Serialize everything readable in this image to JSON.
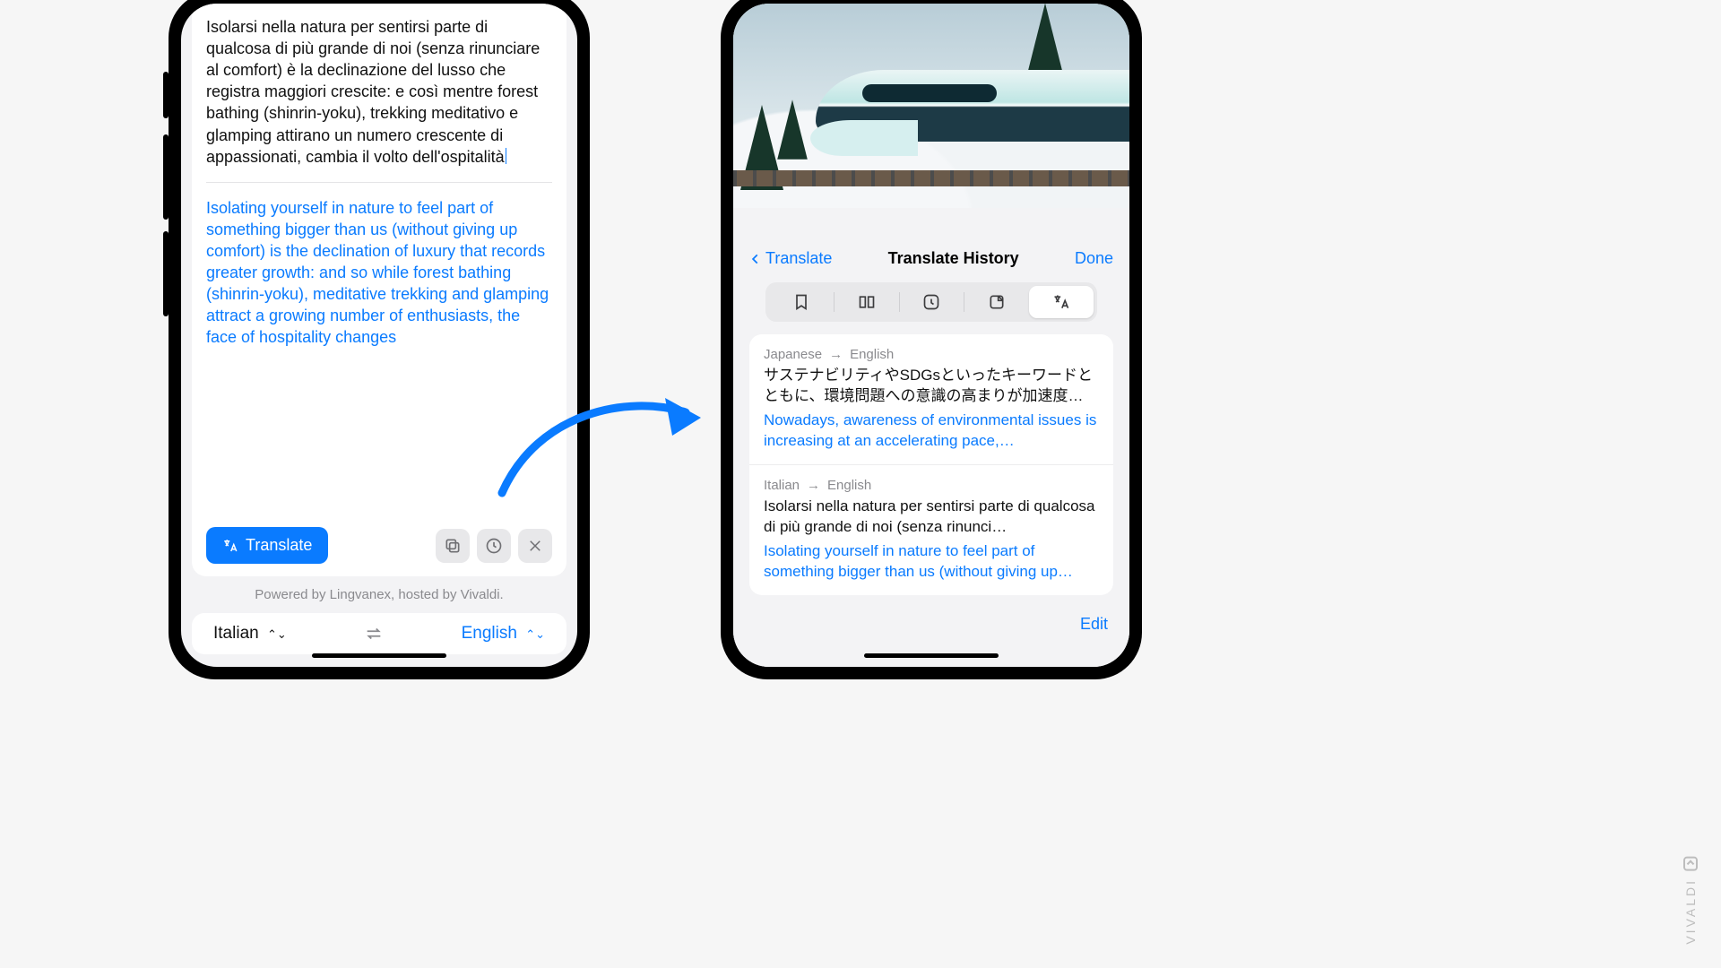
{
  "left": {
    "source_text": "Isolarsi nella natura per sentirsi parte di qualcosa di più grande di noi (senza rinunciare al comfort) è la declinazione del lusso che registra maggiori crescite: e così mentre forest bathing (shinrin-yoku), trekking meditativo e glamping attirano un numero crescente di appassionati, cambia il volto dell'ospitalità",
    "target_text": "Isolating yourself in nature to feel part of something bigger than us (without giving up comfort) is the declination of luxury that records greater growth: and so while forest bathing (shinrin-yoku), meditative trekking and glamping attract a growing number of enthusiasts, the face of hospitality changes",
    "translate_button": "Translate",
    "powered_by": "Powered by Lingvanex, hosted by Vivaldi.",
    "lang_from": "Italian",
    "lang_to": "English"
  },
  "right": {
    "back_label": "Translate",
    "title": "Translate History",
    "done_label": "Done",
    "edit_label": "Edit",
    "history": [
      {
        "from": "Japanese",
        "to": "English",
        "src": "サステナビリティやSDGsといったキーワードとともに、環境問題への意識の高まりが加速度…",
        "tgt": "Nowadays, awareness of environmental issues is increasing at an accelerating pace,…"
      },
      {
        "from": "Italian",
        "to": "English",
        "src": "Isolarsi nella natura per sentirsi parte di qualcosa di più grande di noi (senza rinunci…",
        "tgt": "Isolating yourself in nature to feel part of something bigger than us (without giving up…"
      }
    ]
  },
  "watermark": "VIVALDI"
}
